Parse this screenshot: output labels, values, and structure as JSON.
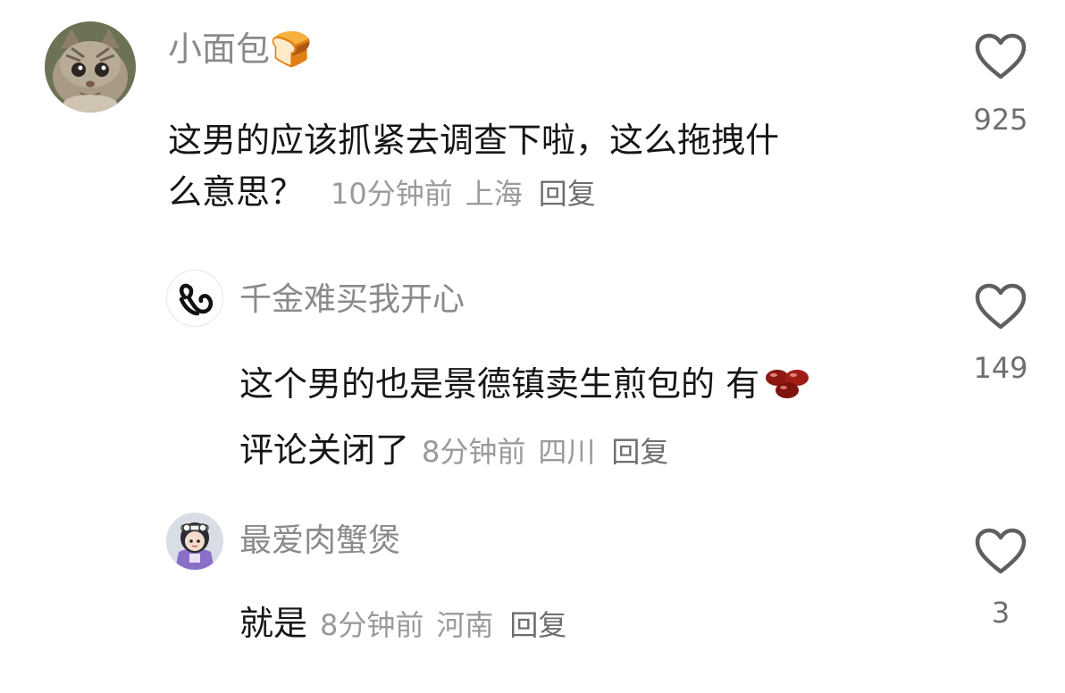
{
  "comments": [
    {
      "username": "小面包🍞",
      "text_line1": "这男的应该抓紧去调查下啦，这么拖拽什",
      "text_line2": "么意思？",
      "time": "10分钟前",
      "location": "上海",
      "reply_label": "回复",
      "likes": "925",
      "avatar_icon": "cat-avatar"
    },
    {
      "username": "千金难买我开心",
      "text_line1": "这个男的也是景德镇卖生煎包的 有",
      "text_line2": "评论关闭了",
      "emoji": "red-beans-emoji",
      "time": "8分钟前",
      "location": "四川",
      "reply_label": "回复",
      "likes": "149",
      "avatar_icon": "heart-logo-avatar"
    },
    {
      "username": "最爱肉蟹煲",
      "text_line1": "就是",
      "time": "8分钟前",
      "location": "河南",
      "reply_label": "回复",
      "likes": "3",
      "avatar_icon": "cartoon-girl-avatar"
    }
  ],
  "colors": {
    "username": "#8a8a8a",
    "text": "#161616",
    "meta": "#9a9a9a",
    "heart_outline": "#5f5f5f"
  }
}
